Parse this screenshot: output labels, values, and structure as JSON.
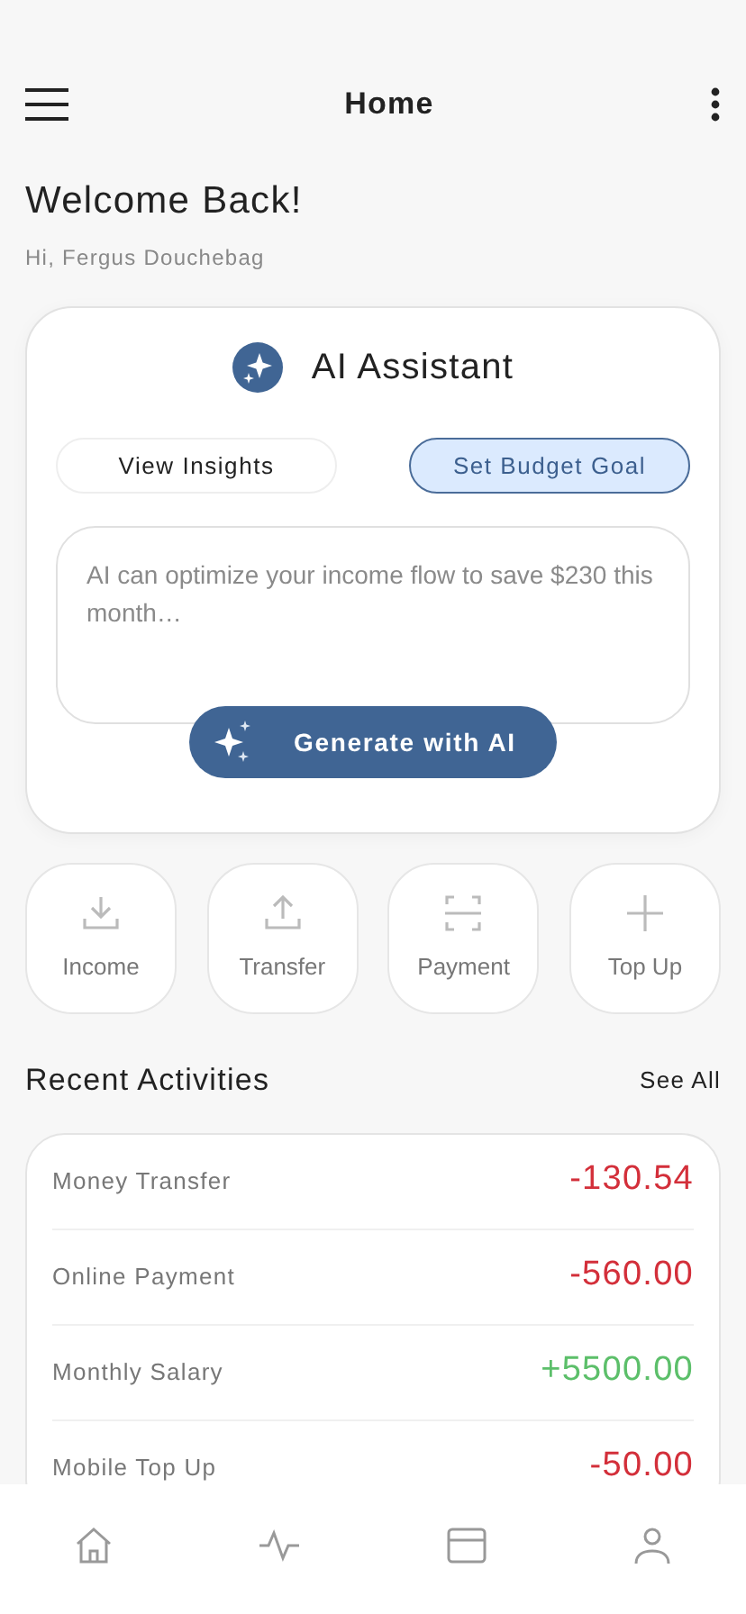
{
  "header": {
    "title": "Home"
  },
  "greeting": {
    "title": "Welcome Back!",
    "subtitle": "Hi, Fergus Douchebag"
  },
  "assistant": {
    "title": "AI Assistant",
    "options": [
      {
        "label": "View Insights",
        "selected": false
      },
      {
        "label": "Set Budget Goal",
        "selected": true
      }
    ],
    "prompt": {
      "placeholder": "AI can optimize your income flow to save $230 this month…"
    },
    "generate_button": "Generate with AI"
  },
  "actions": [
    {
      "kind": "income",
      "label": "Income"
    },
    {
      "kind": "transfer",
      "label": "Transfer"
    },
    {
      "kind": "payment",
      "label": "Payment"
    },
    {
      "kind": "topup",
      "label": "Top Up"
    }
  ],
  "recent": {
    "title": "Recent Activities",
    "link": "See All",
    "items": [
      {
        "name": "Money Transfer",
        "amount": "-130.54",
        "kind": "debit"
      },
      {
        "name": "Online Payment",
        "amount": "-560.00",
        "kind": "debit"
      },
      {
        "name": "Monthly Salary",
        "amount": "+5500.00",
        "kind": "credit"
      },
      {
        "name": "Mobile Top Up",
        "amount": "-50.00",
        "kind": "debit"
      }
    ]
  },
  "bottom_nav": [
    {
      "kind": "home"
    },
    {
      "kind": "activity"
    },
    {
      "kind": "card"
    },
    {
      "kind": "profile"
    }
  ]
}
